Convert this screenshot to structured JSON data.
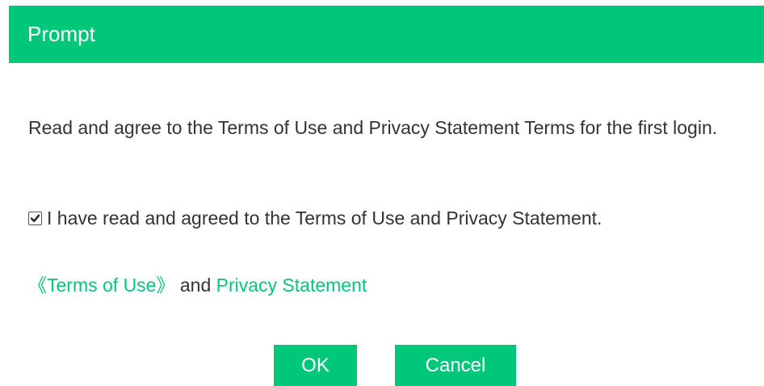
{
  "dialog": {
    "title": "Prompt",
    "message": "Read and agree to the Terms of Use and Privacy Statement Terms for the first login.",
    "checkbox": {
      "checked": true,
      "label": "I have read and agreed to the Terms of Use and Privacy Statement."
    },
    "links": {
      "terms_label": "《Terms of Use》",
      "and_text": "and",
      "privacy_label": "Privacy Statement"
    },
    "buttons": {
      "ok_label": "OK",
      "cancel_label": "Cancel"
    },
    "colors": {
      "accent": "#00c77a",
      "text": "#333333"
    }
  }
}
